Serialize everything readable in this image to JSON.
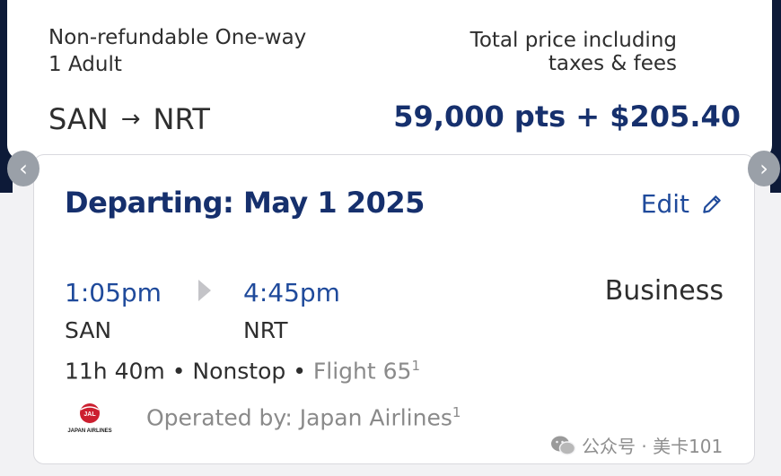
{
  "summary": {
    "fare_type": "Non-refundable One-way",
    "passengers": "1 Adult",
    "origin": "SAN",
    "arrow": "→",
    "destination": "NRT",
    "price_label_line1": "Total price including",
    "price_label_line2": "taxes & fees",
    "price": "59,000 pts + $205.40"
  },
  "flight": {
    "departing": "Departing: May 1 2025",
    "edit_label": "Edit",
    "depart_time": "1:05pm",
    "arrive_time": "4:45pm",
    "depart_code": "SAN",
    "arrive_code": "NRT",
    "cabin": "Business",
    "duration": "11h 40m",
    "separator": " • ",
    "stops": "Nonstop",
    "flight_number": "Flight 65",
    "flight_footnote": "1",
    "operated_by": "Operated by: Japan Airlines",
    "operated_footnote": "1",
    "airline_logo_text": "JAPAN AIRLINES",
    "airline_logo_mark": "JAL"
  },
  "nav": {
    "prev": "‹",
    "next": "›"
  },
  "watermark": {
    "text": "公众号 · 美卡101"
  },
  "colors": {
    "brand_navy": "#16306d",
    "link_blue": "#1f4a9b",
    "jal_red": "#cc1f2f"
  },
  "icons": {
    "arrow": "arrow-right-icon",
    "edit": "pencil-icon",
    "separator": "play-icon",
    "logo": "jal-logo-icon"
  }
}
